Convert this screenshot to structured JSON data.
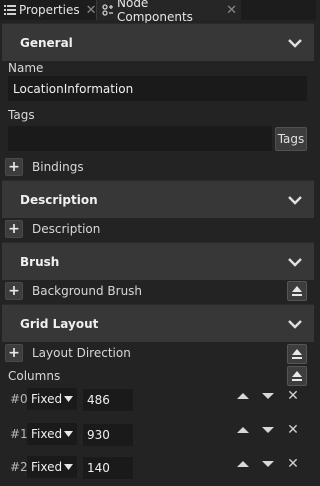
{
  "tabs": [
    {
      "label": "Properties",
      "icon": "list-icon",
      "active": false
    },
    {
      "label": "Node Components",
      "icon": "components-icon",
      "active": true
    }
  ],
  "sections": {
    "general": "General",
    "description": "Description",
    "brush": "Brush",
    "grid_layout": "Grid Layout"
  },
  "general": {
    "name_label": "Name",
    "name_value": "LocationInformation",
    "tags_label": "Tags",
    "tags_value": "",
    "tags_button": "Tags",
    "bindings_label": "Bindings"
  },
  "description": {
    "add_label": "Description"
  },
  "brush": {
    "background_label": "Background Brush"
  },
  "grid_layout": {
    "layout_direction_label": "Layout Direction",
    "columns_label": "Columns",
    "columns": [
      {
        "index": "#0",
        "type": "Fixed",
        "value": "486"
      },
      {
        "index": "#1",
        "type": "Fixed",
        "value": "930"
      },
      {
        "index": "#2",
        "type": "Fixed",
        "value": "140"
      }
    ]
  },
  "colors": {
    "background": "#232323",
    "section_header": "#373737",
    "input_bg": "#1a1a1a",
    "text": "#d8d8d8"
  }
}
